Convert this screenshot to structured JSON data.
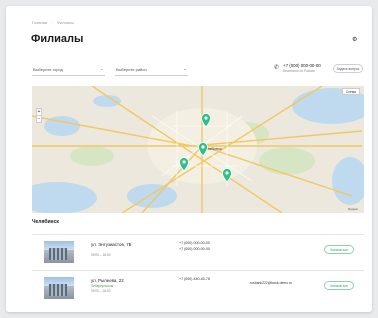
{
  "breadcrumb": [
    "Главная",
    "Филиалы"
  ],
  "page_title": "Филиалы",
  "filters": {
    "city_placeholder": "Выберите город",
    "district_placeholder": "Выберите район"
  },
  "contact": {
    "phone": "+7 (000) 000-00-00",
    "phone_note": "Бесплатно по России",
    "callback_label": "Задать вопрос"
  },
  "map": {
    "scale_button": "Схема",
    "zoom_in": "+",
    "zoom_out": "−",
    "city_label": "Челябинск",
    "footer": "Яндекс",
    "pin_color": "#2fbf8a"
  },
  "section_title": "Челябинск",
  "branches": [
    {
      "address": "ул. Энтузиастов, 7Б",
      "metro": "",
      "hours": "09:00 – 18:00",
      "phone1": "+7 (000) 000-00-00",
      "phone2": "+7 (000) 000-00-00",
      "email": "",
      "button": "Записаться"
    },
    {
      "address": "ул. Рылеева, 22",
      "metro": "Чебаркульская",
      "hours": "09:00 – 18:00",
      "phone1": "+7 (000) 440-45-78",
      "phone2": "",
      "email": "rusbank222@bank-demo.ru",
      "button": "Записаться"
    }
  ]
}
